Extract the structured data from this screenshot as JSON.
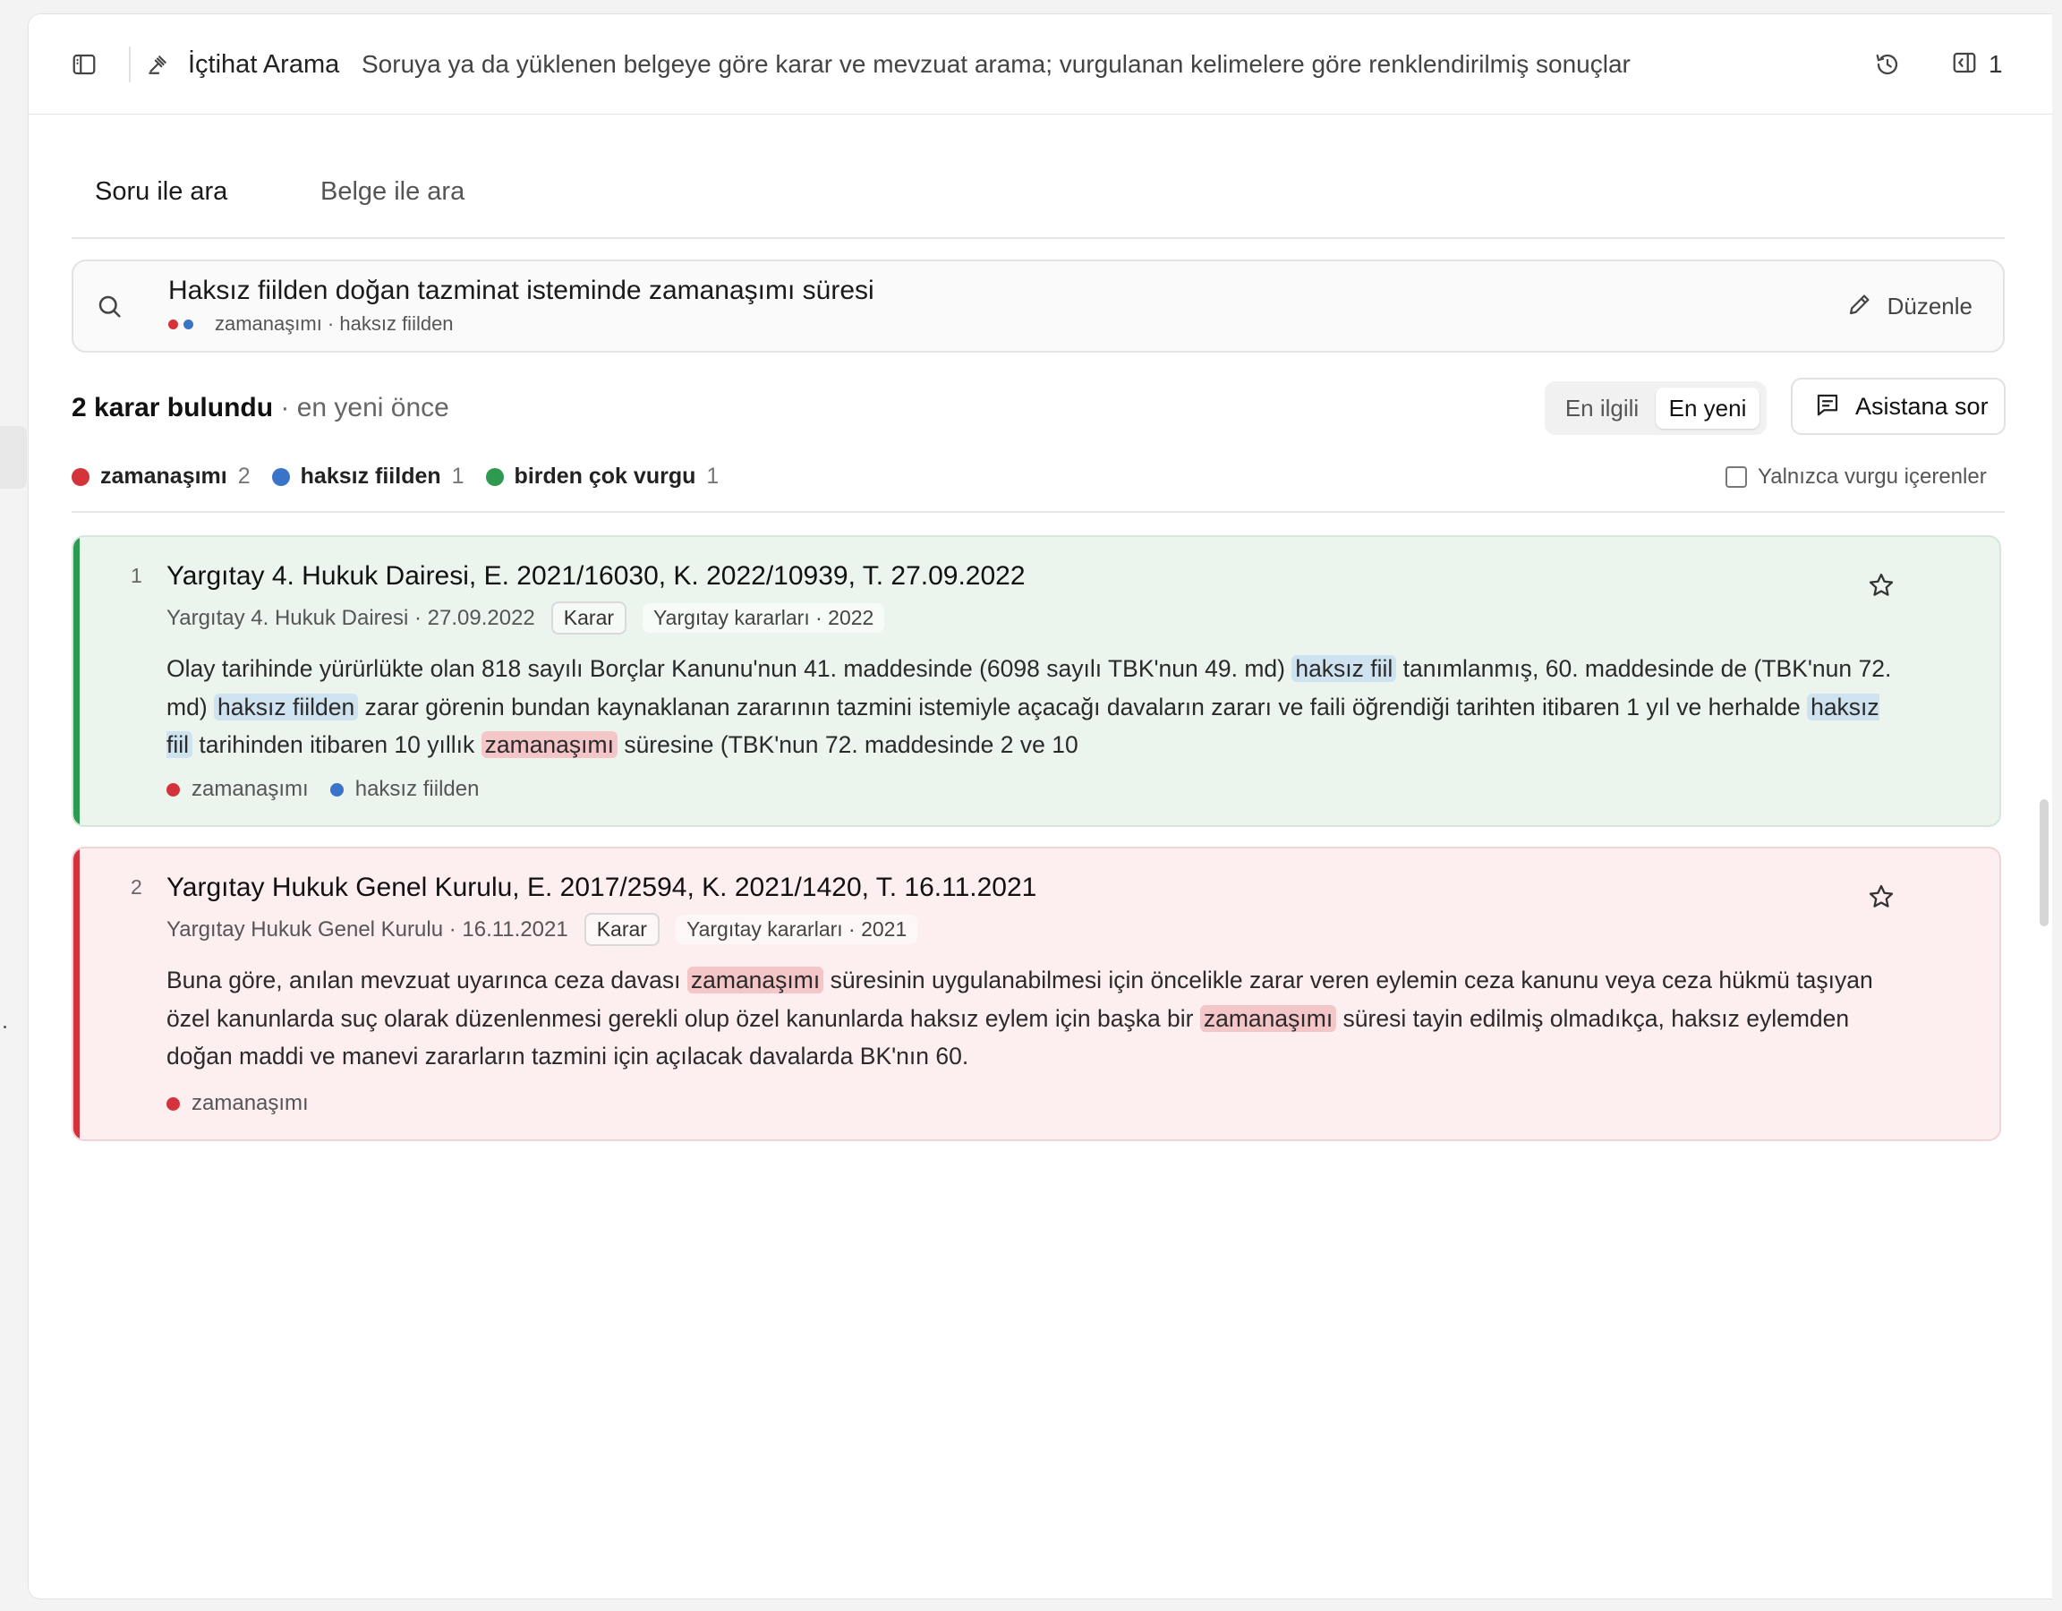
{
  "header": {
    "title": "İçtihat Arama",
    "subtitle": "Soruya ya da yüklenen belgeye göre karar ve mevzuat arama; vurgulanan kelimelere göre renklendirilmiş sonuçlar",
    "panel_count": "1",
    "icons": [
      "sidebar-icon",
      "gavel-icon",
      "history-icon",
      "panel-icon"
    ]
  },
  "tabs": [
    {
      "label": "Soru ile ara",
      "active": true
    },
    {
      "label": "Belge ile ara",
      "active": false
    }
  ],
  "search": {
    "query": "Haksız fiilden doğan tazminat isteminde zamanaşımı süresi",
    "tags_text": "zamanaşımı · haksız fiilden",
    "edit_label": "Düzenle"
  },
  "results": {
    "count_text": "2 karar bulundu",
    "order_text": " · en yeni önce",
    "sort_options": [
      "En ilgili",
      "En yeni"
    ],
    "sort_selected": "En yeni",
    "assist_label": "Asistana sor"
  },
  "legend": [
    {
      "label": "zamanaşımı",
      "count": "2",
      "color": "#d5333b"
    },
    {
      "label": "haksız fiilden",
      "count": "1",
      "color": "#3a74c9"
    },
    {
      "label": "birden çok vurgu",
      "count": "1",
      "color": "#2e9a50"
    }
  ],
  "filter": {
    "label": "Yalnızca vurgu içerenler",
    "checked": false
  },
  "cards": [
    {
      "num": "1",
      "title": "Yargıtay 4. Hukuk Dairesi, E. 2021/16030, K. 2022/10939, T. 27.09.2022",
      "meta": "Yargıtay 4. Hukuk Dairesi · 27.09.2022",
      "badge": "Karar",
      "collection": "Yargıtay kararları · 2022",
      "body": [
        {
          "t": "Olay tarihinde yürürlükte olan 818 sayılı Borçlar Kanunu'nun 41. maddesinde (6098 sayılı TBK'nun 49. md) "
        },
        {
          "t": "haksız fiil",
          "hl": "blue"
        },
        {
          "t": " tanımlanmış, 60. maddesinde de (TBK'nun 72. md) "
        },
        {
          "t": "haksız fiilden",
          "hl": "blue"
        },
        {
          "t": " zarar görenin bundan kaynaklanan zararının tazmini istemiyle açacağı davaların zararı ve faili öğrendiği tarihten itibaren 1 yıl ve herhalde "
        },
        {
          "t": "haksız fiil",
          "hl": "blue"
        },
        {
          "t": " tarihinden itibaren 10 yıllık "
        },
        {
          "t": "zamanaşımı",
          "hl": "red"
        },
        {
          "t": " süresine (TBK'nun 72. maddesinde 2 ve 10"
        }
      ],
      "tags": [
        {
          "label": "zamanaşımı",
          "color": "#d5333b"
        },
        {
          "label": "haksız fiilden",
          "color": "#3a74c9"
        }
      ],
      "color": "#2e9a50"
    },
    {
      "num": "2",
      "title": "Yargıtay Hukuk Genel Kurulu, E. 2017/2594, K. 2021/1420, T. 16.11.2021",
      "meta": "Yargıtay Hukuk Genel Kurulu · 16.11.2021",
      "badge": "Karar",
      "collection": "Yargıtay kararları · 2021",
      "body": [
        {
          "t": "Buna göre, anılan mevzuat uyarınca ceza davası "
        },
        {
          "t": "zamanaşımı",
          "hl": "red"
        },
        {
          "t": " süresinin uygulanabilmesi için öncelikle zarar veren eylemin ceza kanunu veya ceza hükmü taşıyan özel kanunlarda suç olarak düzenlenmesi gerekli olup özel kanunlarda haksız eylem için başka bir "
        },
        {
          "t": "zamanaşımı",
          "hl": "red"
        },
        {
          "t": " süresi tayin edilmiş olmadıkça, haksız eylemden doğan maddi ve manevi zararların tazmini için açılacak davalarda BK'nın 60."
        }
      ],
      "tags": [
        {
          "label": "zamanaşımı",
          "color": "#d5333b"
        }
      ],
      "color": "#d5333b"
    }
  ]
}
